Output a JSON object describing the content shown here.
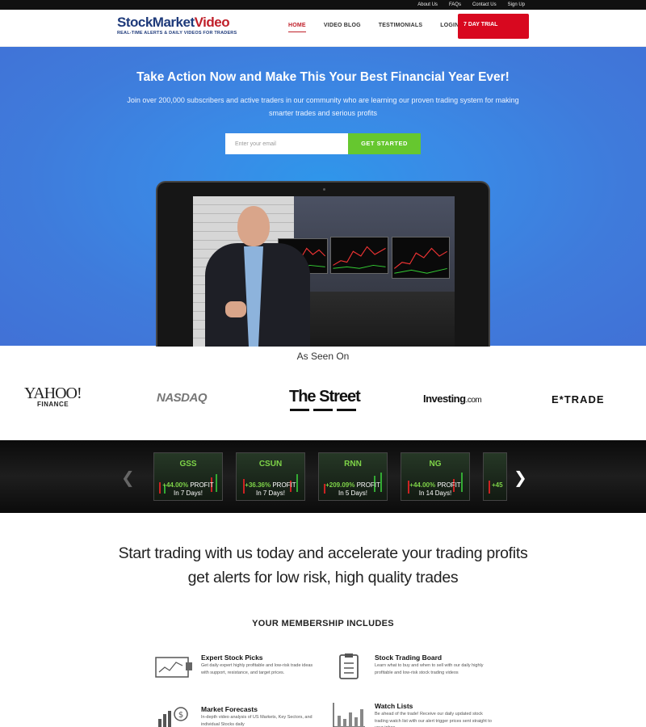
{
  "topbar": {
    "links": [
      "About Us",
      "FAQs",
      "Contact Us",
      "Sign Up"
    ]
  },
  "header": {
    "logo_part1": "Stock",
    "logo_part2": "Market",
    "logo_part3": "Video",
    "logo_tagline": "REAL-TIME ALERTS & DAILY VIDEOS FOR TRADERS",
    "nav": [
      "HOME",
      "VIDEO BLOG",
      "TESTIMONIALS",
      "LOGIN"
    ],
    "active_nav": "HOME",
    "trial_button": "7 DAY TRIAL"
  },
  "hero": {
    "title": "Take Action Now and Make This Your Best Financial Year Ever!",
    "subtitle": "Join over 200,000 subscribers and active traders in our community who are learning our proven trading system for making smarter trades and serious profits",
    "email_placeholder": "Enter your email",
    "cta_button": "GET STARTED"
  },
  "seen_on": {
    "title": "As Seen On",
    "logos": {
      "yahoo": "YAHOO!",
      "yahoo_sub": "FINANCE",
      "nasdaq": "NASDAQ",
      "thestreet": "The Street",
      "investing": "Investing",
      "investing_suffix": ".com",
      "etrade": "E*TRADE"
    }
  },
  "carousel": {
    "cards": [
      {
        "ticker": "GSS",
        "pct": "+44.00%",
        "label": "PROFIT",
        "days": "In 7 Days!"
      },
      {
        "ticker": "CSUN",
        "pct": "+36.36%",
        "label": "PROFIT",
        "days": "In 7 Days!"
      },
      {
        "ticker": "RNN",
        "pct": "+209.09%",
        "label": "PROFIT",
        "days": "In 5 Days!"
      },
      {
        "ticker": "NG",
        "pct": "+44.00%",
        "label": "PROFIT",
        "days": "In 14 Days!"
      },
      {
        "ticker": "",
        "pct": "+45",
        "label": "",
        "days": ""
      }
    ]
  },
  "main": {
    "headline_line1": "Start trading with us today and accelerate your trading profits",
    "headline_line2": "get alerts for low risk, high quality trades",
    "membership_title": "YOUR MEMBERSHIP INCLUDES",
    "features": [
      {
        "title": "Expert Stock Picks",
        "desc": "Get daily expert highly profitable and low-risk trade ideas with support, resistance, and target prices.",
        "icon": "chart-screen-icon"
      },
      {
        "title": "Stock Trading Board",
        "desc": "Learn what to buy and when to sell with our daily highly profitable and low-risk stock trading videos",
        "icon": "clipboard-icon"
      },
      {
        "title": "Market Forecasts",
        "desc": "In-depth video analysis of US Markets, Key Sectors, and individual Stocks daily",
        "icon": "bar-chart-dollar-icon"
      },
      {
        "title": "Watch Lists",
        "desc": "Be ahead of the trade! Receive our daily updated stock trading watch list with our alert trigger prices sent straight to your inbox",
        "icon": "bar-chart-icon"
      }
    ]
  }
}
